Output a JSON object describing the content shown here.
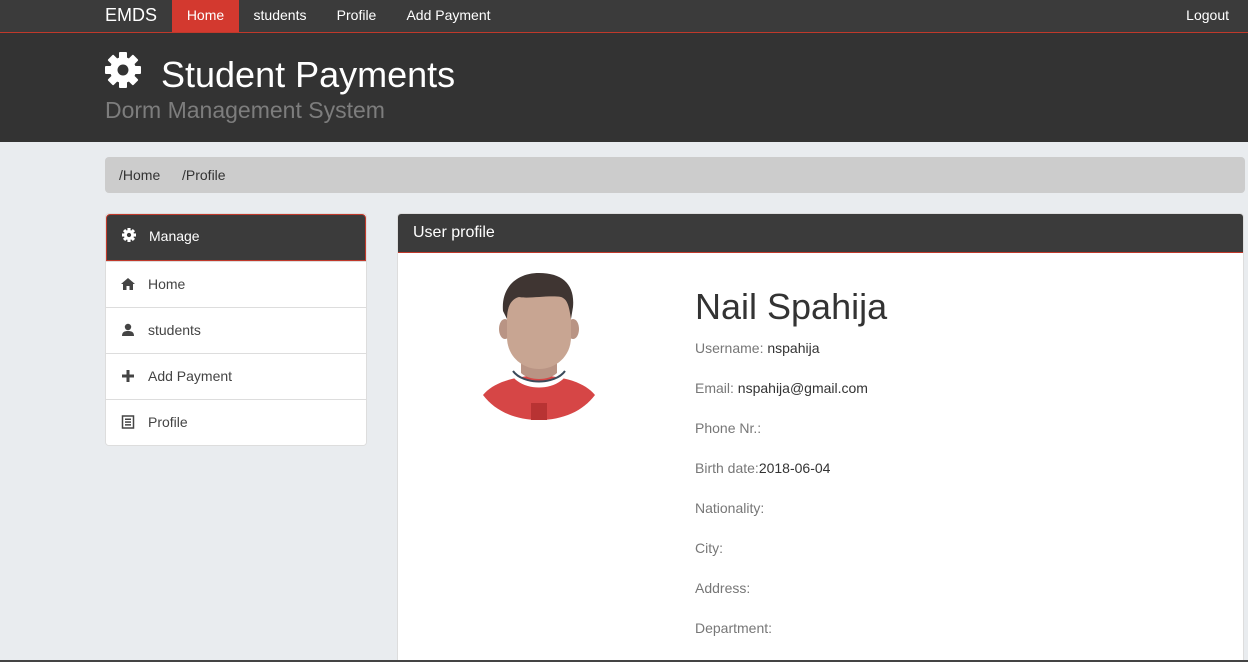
{
  "navbar": {
    "brand": "EMDS",
    "items": [
      {
        "label": "Home",
        "active": true
      },
      {
        "label": "students",
        "active": false
      },
      {
        "label": "Profile",
        "active": false
      },
      {
        "label": "Add Payment",
        "active": false
      }
    ],
    "logout": "Logout"
  },
  "header": {
    "icon": "gear-icon",
    "title": "Student Payments",
    "subtitle": "Dorm Management System"
  },
  "breadcrumb": [
    "/Home",
    "/Profile"
  ],
  "sidebar": {
    "heading": {
      "label": "Manage",
      "icon": "gear-icon"
    },
    "items": [
      {
        "label": "Home",
        "icon": "home-icon"
      },
      {
        "label": "students",
        "icon": "user-icon"
      },
      {
        "label": "Add Payment",
        "icon": "plus-icon"
      },
      {
        "label": "Profile",
        "icon": "list-icon"
      }
    ]
  },
  "profile": {
    "panel_title": "User profile",
    "name": "Nail Spahija",
    "fields": [
      {
        "label": "Username: ",
        "value": "nspahija"
      },
      {
        "label": "Email: ",
        "value": "nspahija@gmail.com"
      },
      {
        "label": "Phone Nr.:",
        "value": ""
      },
      {
        "label": "Birth date:",
        "value": "2018-06-04"
      },
      {
        "label": "Nationality:",
        "value": ""
      },
      {
        "label": "City:",
        "value": ""
      },
      {
        "label": "Address:",
        "value": ""
      },
      {
        "label": "Department:",
        "value": ""
      }
    ]
  },
  "colors": {
    "accent": "#d3392f",
    "dark": "#333333",
    "navbar": "#3b3b3b",
    "background": "#e9ecef"
  }
}
